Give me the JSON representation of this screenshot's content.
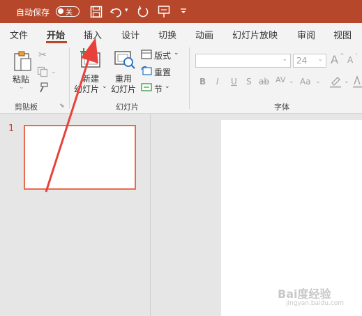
{
  "titlebar": {
    "autosave_label": "自动保存",
    "autosave_state": "关",
    "save_icon": "save-icon",
    "undo_icon": "undo-icon",
    "redo_icon": "redo-icon",
    "present_icon": "present-icon",
    "customize_icon": "customize-qat-icon",
    "colors": {
      "bg": "#b7472a"
    }
  },
  "tabs": [
    {
      "label": "文件"
    },
    {
      "label": "开始",
      "active": true
    },
    {
      "label": "插入"
    },
    {
      "label": "设计"
    },
    {
      "label": "切换"
    },
    {
      "label": "动画"
    },
    {
      "label": "幻灯片放映"
    },
    {
      "label": "审阅"
    },
    {
      "label": "视图"
    }
  ],
  "ribbon": {
    "clipboard": {
      "paste": "粘贴",
      "group_label": "剪贴板"
    },
    "slides": {
      "new_slide_1": "新建",
      "new_slide_2": "幻灯片",
      "reuse_1": "重用",
      "reuse_2": "幻灯片",
      "layout": "版式",
      "reset": "重置",
      "section": "节",
      "group_label": "幻灯片"
    },
    "font": {
      "font_size": "24",
      "bold": "B",
      "italic": "I",
      "underline": "U",
      "shadow": "S",
      "strike": "ab",
      "spacing": "AV",
      "case": "Aa",
      "grow": "A",
      "shrink": "A",
      "group_label": "字体"
    }
  },
  "slides_panel": {
    "slide_number": "1"
  },
  "watermark": {
    "line1": "Bai度经验",
    "line2": "jingyan.baidu.com"
  }
}
